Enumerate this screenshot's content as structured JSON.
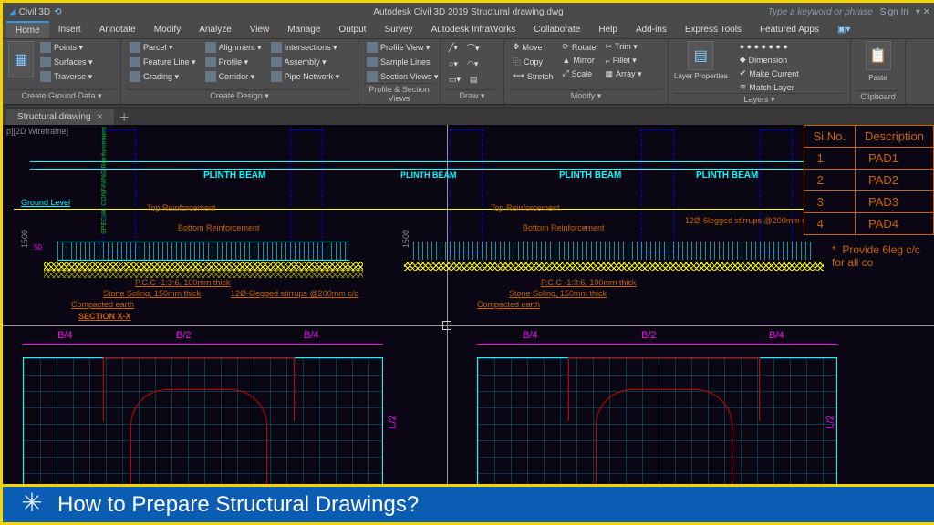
{
  "title": {
    "left": "Civil 3D",
    "center": "Autodesk Civil 3D 2019   Structural drawing.dwg",
    "search": "Type a keyword or phrase",
    "signin": "Sign In"
  },
  "menu": [
    "Home",
    "Insert",
    "Annotate",
    "Modify",
    "Analyze",
    "View",
    "Manage",
    "Output",
    "Survey",
    "Autodesk InfraWorks",
    "Collaborate",
    "Help",
    "Add-ins",
    "Express Tools",
    "Featured Apps"
  ],
  "panels": {
    "ground": {
      "title": "Create Ground Data ▾",
      "items": [
        "Points ▾",
        "Surfaces ▾",
        "Traverse ▾"
      ]
    },
    "design": {
      "title": "Create Design ▾",
      "items1": [
        "Parcel ▾",
        "Feature Line ▾",
        "Grading ▾"
      ],
      "items2": [
        "Alignment ▾",
        "Profile ▾",
        "Corridor ▾"
      ],
      "items3": [
        "Intersections ▾",
        "Assembly ▾",
        "Pipe Network ▾"
      ]
    },
    "profile": {
      "title": "Profile & Section Views",
      "items": [
        "Profile View ▾",
        "Sample Lines",
        "Section Views ▾"
      ]
    },
    "draw": {
      "title": "Draw ▾"
    },
    "modify": {
      "title": "Modify ▾",
      "items1": [
        "Move",
        "Copy",
        "Stretch"
      ],
      "items2": [
        "Rotate",
        "Mirror",
        "Scale"
      ],
      "items3": [
        "Trim ▾",
        "Fillet ▾",
        "Array ▾"
      ]
    },
    "layers": {
      "title": "Layers ▾",
      "label": "Layer Properties",
      "items": [
        "Dimension",
        "Make Current",
        "Match Layer"
      ]
    },
    "clip": {
      "title": "Clipboard",
      "label": "Paste"
    }
  },
  "doc_tab": "Structural drawing",
  "view_label": "p][2D Wireframe]",
  "cad": {
    "plinth": "PLINTH BEAM",
    "ground": "Ground Level",
    "top_r": "Top Reinforcement",
    "bot_r": "Bottom Reinforcement",
    "stir": "12Ø-6legged stirrups @200mm c/c",
    "pcc": "P.C.C -1:3:6, 100mm thick",
    "stone": "Stone Soling, 150mm thick",
    "comp": "Compacted earth",
    "section": "SECTION X-X",
    "dim1500": "1500",
    "dim50": "50",
    "b4": "B/4",
    "b2": "B/2",
    "l2": "L/2"
  },
  "table": {
    "h1": "Si.No.",
    "h2": "Description",
    "rows": [
      {
        "n": "1",
        "d": "PAD1"
      },
      {
        "n": "2",
        "d": "PAD2"
      },
      {
        "n": "3",
        "d": "PAD3"
      },
      {
        "n": "4",
        "d": "PAD4"
      }
    ],
    "note_star": "*",
    "note": "Provide 6leg c/c for all co"
  },
  "footer": "How to Prepare Structural Drawings?"
}
